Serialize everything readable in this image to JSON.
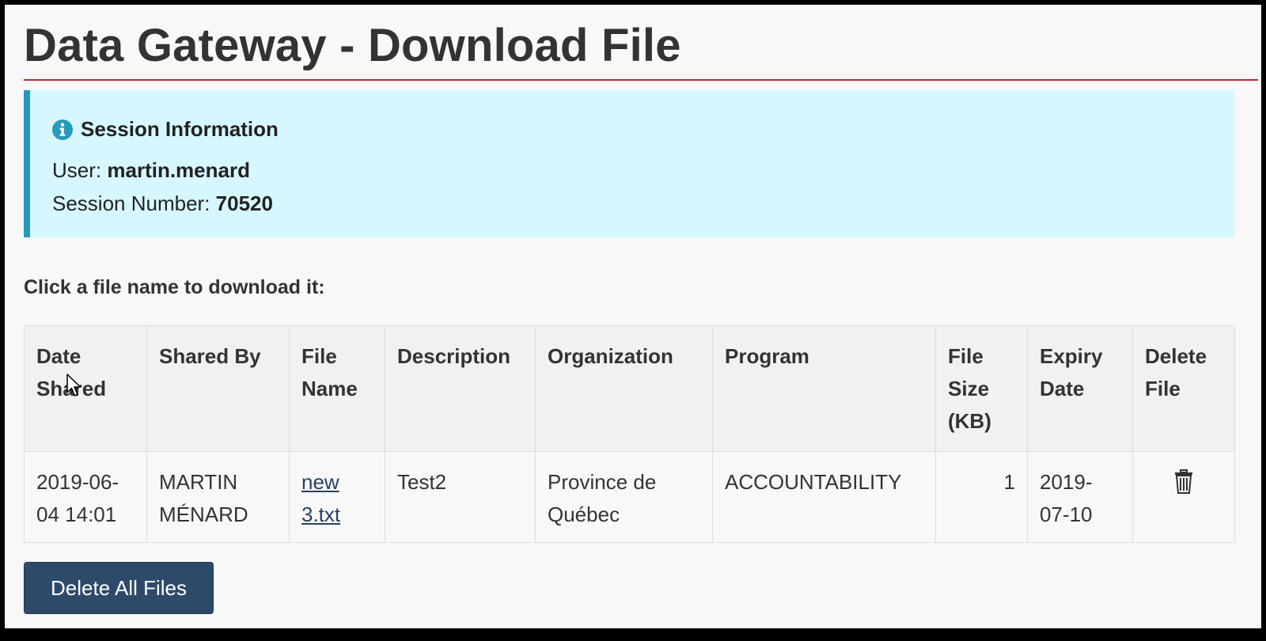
{
  "page": {
    "title": "Data Gateway - Download File"
  },
  "session": {
    "heading": "Session Information",
    "user_label": "User:",
    "user_value": "martin.menard",
    "number_label": "Session Number:",
    "number_value": "70520"
  },
  "instruction": "Click a file name to download it:",
  "table": {
    "headers": [
      [
        "Date",
        "Shared"
      ],
      [
        "Shared By"
      ],
      [
        "File",
        "Name"
      ],
      [
        "Description"
      ],
      [
        "Organization"
      ],
      [
        "Program"
      ],
      [
        "File",
        "Size",
        "(KB)"
      ],
      [
        "Expiry",
        "Date"
      ],
      [
        "Delete",
        "File"
      ]
    ],
    "rows": [
      {
        "date_shared": [
          "2019-06-",
          "04 14:01"
        ],
        "shared_by": [
          "MARTIN",
          "MÉNARD"
        ],
        "file_name": [
          "new",
          "3.txt"
        ],
        "description": "Test2",
        "organization": [
          "Province de",
          "Québec"
        ],
        "program": "ACCOUNTABILITY",
        "file_size": "1",
        "expiry_date": [
          "2019-",
          "07-10"
        ],
        "delete_icon": "trash-icon"
      }
    ]
  },
  "actions": {
    "delete_all_label": "Delete All Files"
  },
  "colors": {
    "title_rule": "#d2232a",
    "alert_bg": "#d7f7ff",
    "alert_border": "#269abc",
    "button_bg": "#2e4a6b",
    "link": "#284162"
  }
}
